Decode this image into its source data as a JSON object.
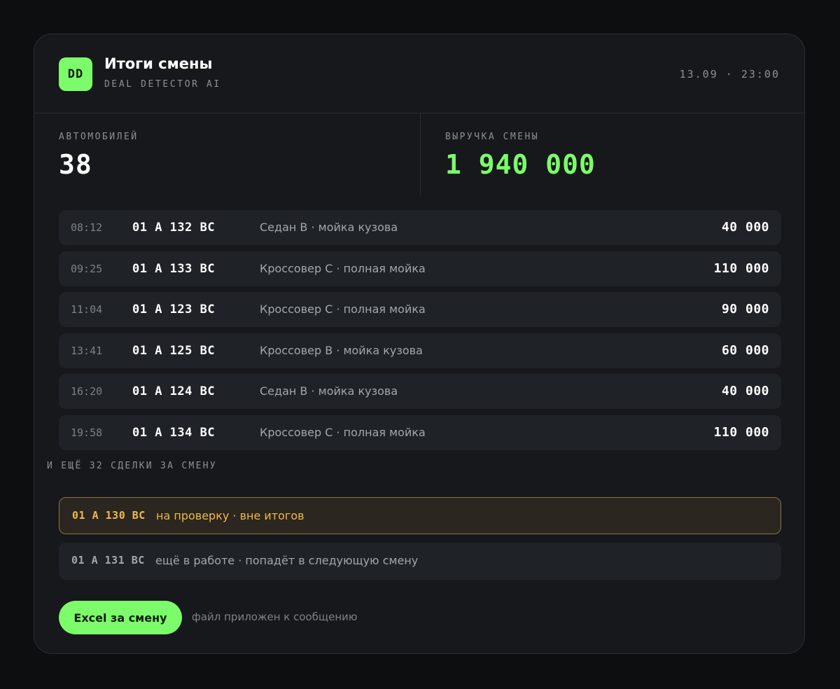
{
  "header": {
    "logo_text": "DD",
    "title": "Итоги смены",
    "subtitle": "DEAL DETECTOR AI",
    "datetime": "13.09 · 23:00"
  },
  "stats": {
    "cars_label": "АВТОМОБИЛЕЙ",
    "cars_value": "38",
    "revenue_label": "ВЫРУЧКА СМЕНЫ",
    "revenue_value": "1 940 000"
  },
  "deals": [
    {
      "time": "08:12",
      "plate": "01 A 132 BC",
      "desc": "Седан B · мойка кузова",
      "amount": "40 000"
    },
    {
      "time": "09:25",
      "plate": "01 A 133 BC",
      "desc": "Кроссовер C · полная мойка",
      "amount": "110 000"
    },
    {
      "time": "11:04",
      "plate": "01 A 123 BC",
      "desc": "Кроссовер C · полная мойка",
      "amount": "90 000"
    },
    {
      "time": "13:41",
      "plate": "01 A 125 BC",
      "desc": "Кроссовер B · мойка кузова",
      "amount": "60 000"
    },
    {
      "time": "16:20",
      "plate": "01 A 124 BC",
      "desc": "Седан B · мойка кузова",
      "amount": "40 000"
    },
    {
      "time": "19:58",
      "plate": "01 A 134 BC",
      "desc": "Кроссовер C · полная мойка",
      "amount": "110 000"
    }
  ],
  "more_text": "И ЕЩЁ 32 СДЕЛКИ ЗА СМЕНУ",
  "flags": {
    "review": {
      "plate": "01 A 130 BC",
      "text": "на проверку · вне итогов"
    },
    "in_progress": {
      "plate": "01 A 131 BC",
      "text": "ещё в работе · попадёт в следующую смену"
    }
  },
  "footer": {
    "excel_button": "Excel за смену",
    "note": "файл приложен к сообщению"
  },
  "colors": {
    "accent": "#7cfc6a",
    "review_text": "#f2b84a",
    "muted": "#8d9096"
  }
}
